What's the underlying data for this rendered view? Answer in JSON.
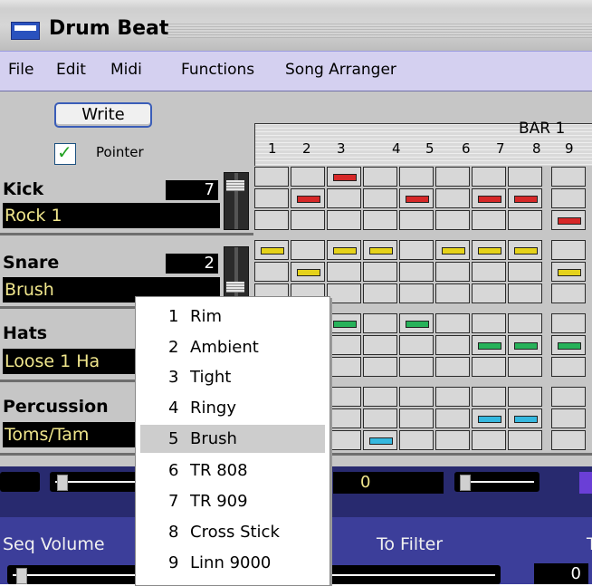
{
  "window": {
    "title": "Drum Beat"
  },
  "menu": [
    "File",
    "Edit",
    "Midi",
    "Functions",
    "Song Arranger"
  ],
  "controls": {
    "write_label": "Write",
    "pointer_label": "Pointer",
    "pointer_checked": true
  },
  "grid_header": {
    "bar_label": "BAR 1",
    "steps": [
      "1",
      "2",
      "3",
      "4",
      "5",
      "6",
      "7",
      "8",
      "9"
    ]
  },
  "instruments": [
    {
      "name": "Kick",
      "number": "7",
      "kit": "Rock 1"
    },
    {
      "name": "Snare",
      "number": "2",
      "kit": "Brush"
    },
    {
      "name": "Hats",
      "number": "",
      "kit": "Loose 1 Ha"
    },
    {
      "name": "Percussion",
      "number": "",
      "kit": "Toms/Tam"
    }
  ],
  "bottom": {
    "readout_a": "0",
    "readout_b": "0",
    "seq_volume_label": "Seq Volume",
    "to_filter_label": "To Filter",
    "tail_label": "T"
  },
  "popup": {
    "selected_index": 4,
    "items": [
      {
        "num": "1",
        "label": "Rim"
      },
      {
        "num": "2",
        "label": "Ambient"
      },
      {
        "num": "3",
        "label": "Tight"
      },
      {
        "num": "4",
        "label": "Ringy"
      },
      {
        "num": "5",
        "label": "Brush"
      },
      {
        "num": "6",
        "label": "TR 808"
      },
      {
        "num": "7",
        "label": "TR 909"
      },
      {
        "num": "8",
        "label": "Cross Stick"
      },
      {
        "num": "9",
        "label": "Linn 9000"
      }
    ]
  },
  "colors": {
    "kick": "#d62828",
    "snare": "#e5d21a",
    "hats": "#27b25a",
    "percussion": "#35b8df"
  },
  "pattern": {
    "kick": [
      [
        0,
        0,
        1,
        0,
        0,
        0,
        0,
        0,
        0
      ],
      [
        0,
        1,
        0,
        0,
        1,
        0,
        1,
        1,
        0
      ],
      [
        0,
        0,
        0,
        0,
        0,
        0,
        0,
        0,
        1
      ]
    ],
    "snare": [
      [
        1,
        0,
        1,
        1,
        0,
        1,
        1,
        1,
        0
      ],
      [
        0,
        1,
        0,
        0,
        0,
        0,
        0,
        0,
        1
      ],
      [
        0,
        0,
        0,
        0,
        0,
        0,
        0,
        0,
        0
      ]
    ],
    "hats": [
      [
        0,
        0,
        1,
        0,
        1,
        0,
        0,
        0,
        0
      ],
      [
        0,
        0,
        0,
        0,
        0,
        0,
        1,
        1,
        1
      ],
      [
        0,
        0,
        0,
        0,
        0,
        0,
        0,
        0,
        0
      ]
    ],
    "percussion": [
      [
        0,
        0,
        0,
        0,
        0,
        0,
        0,
        0,
        0
      ],
      [
        0,
        0,
        0,
        0,
        0,
        0,
        1,
        1,
        0
      ],
      [
        0,
        0,
        0,
        1,
        0,
        0,
        0,
        0,
        0
      ]
    ]
  }
}
